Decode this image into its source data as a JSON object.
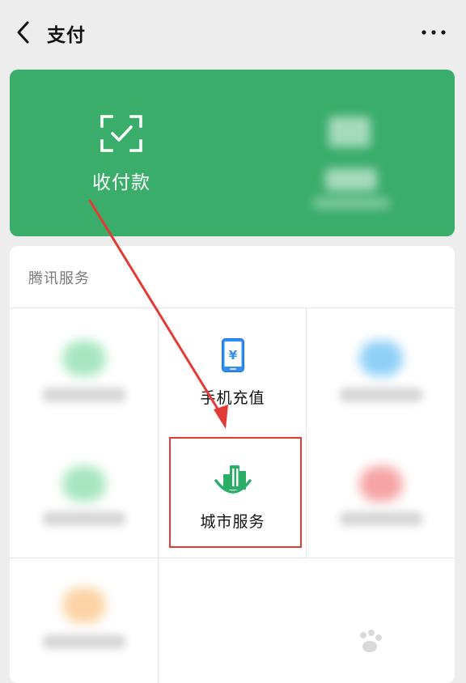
{
  "nav": {
    "title": "支付"
  },
  "pay_card": {
    "label": "收付款"
  },
  "services": {
    "section_title": "腾讯服务",
    "items": [
      {
        "label": "手机充值",
        "icon": "phone-recharge-icon"
      },
      {
        "label": "城市服务",
        "icon": "city-service-icon"
      }
    ]
  },
  "colors": {
    "wechat_green": "#3aad6a",
    "highlight_red": "#e23b36"
  }
}
